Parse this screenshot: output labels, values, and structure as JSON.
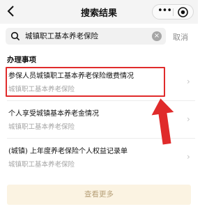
{
  "header": {
    "title": "搜索结果",
    "capsule_menu": "•••"
  },
  "search": {
    "query": "城镇职工基本养老保险",
    "clear_glyph": "×",
    "cancel_label": "取消"
  },
  "section": {
    "title": "办理事项"
  },
  "results": [
    {
      "title": "参保人员城镇职工基本养老保险缴费情况",
      "subtitle": "城镇职工基本养老保险"
    },
    {
      "title": "个人享受城镇基本养老金情况",
      "subtitle": "城镇职工基本养老保险"
    },
    {
      "title": "(城镇) 上年度养老保险个人权益记录单",
      "subtitle": "城镇职工基本养老保险"
    }
  ],
  "more_button": {
    "label": "查看更多"
  },
  "icons": {
    "back": "back-icon",
    "more": "more-dots-icon",
    "close_mini_program": "target-icon",
    "search": "search-icon",
    "clear": "clear-icon",
    "chevron": "chevron-right-icon"
  },
  "colors": {
    "highlight": "#e02b2b",
    "more_button_bg": "#fbf3e2",
    "more_button_text": "#b8a27a",
    "subtitle_text": "#a6a6a6"
  },
  "annotation": {
    "highlighted_result_index": 0
  }
}
